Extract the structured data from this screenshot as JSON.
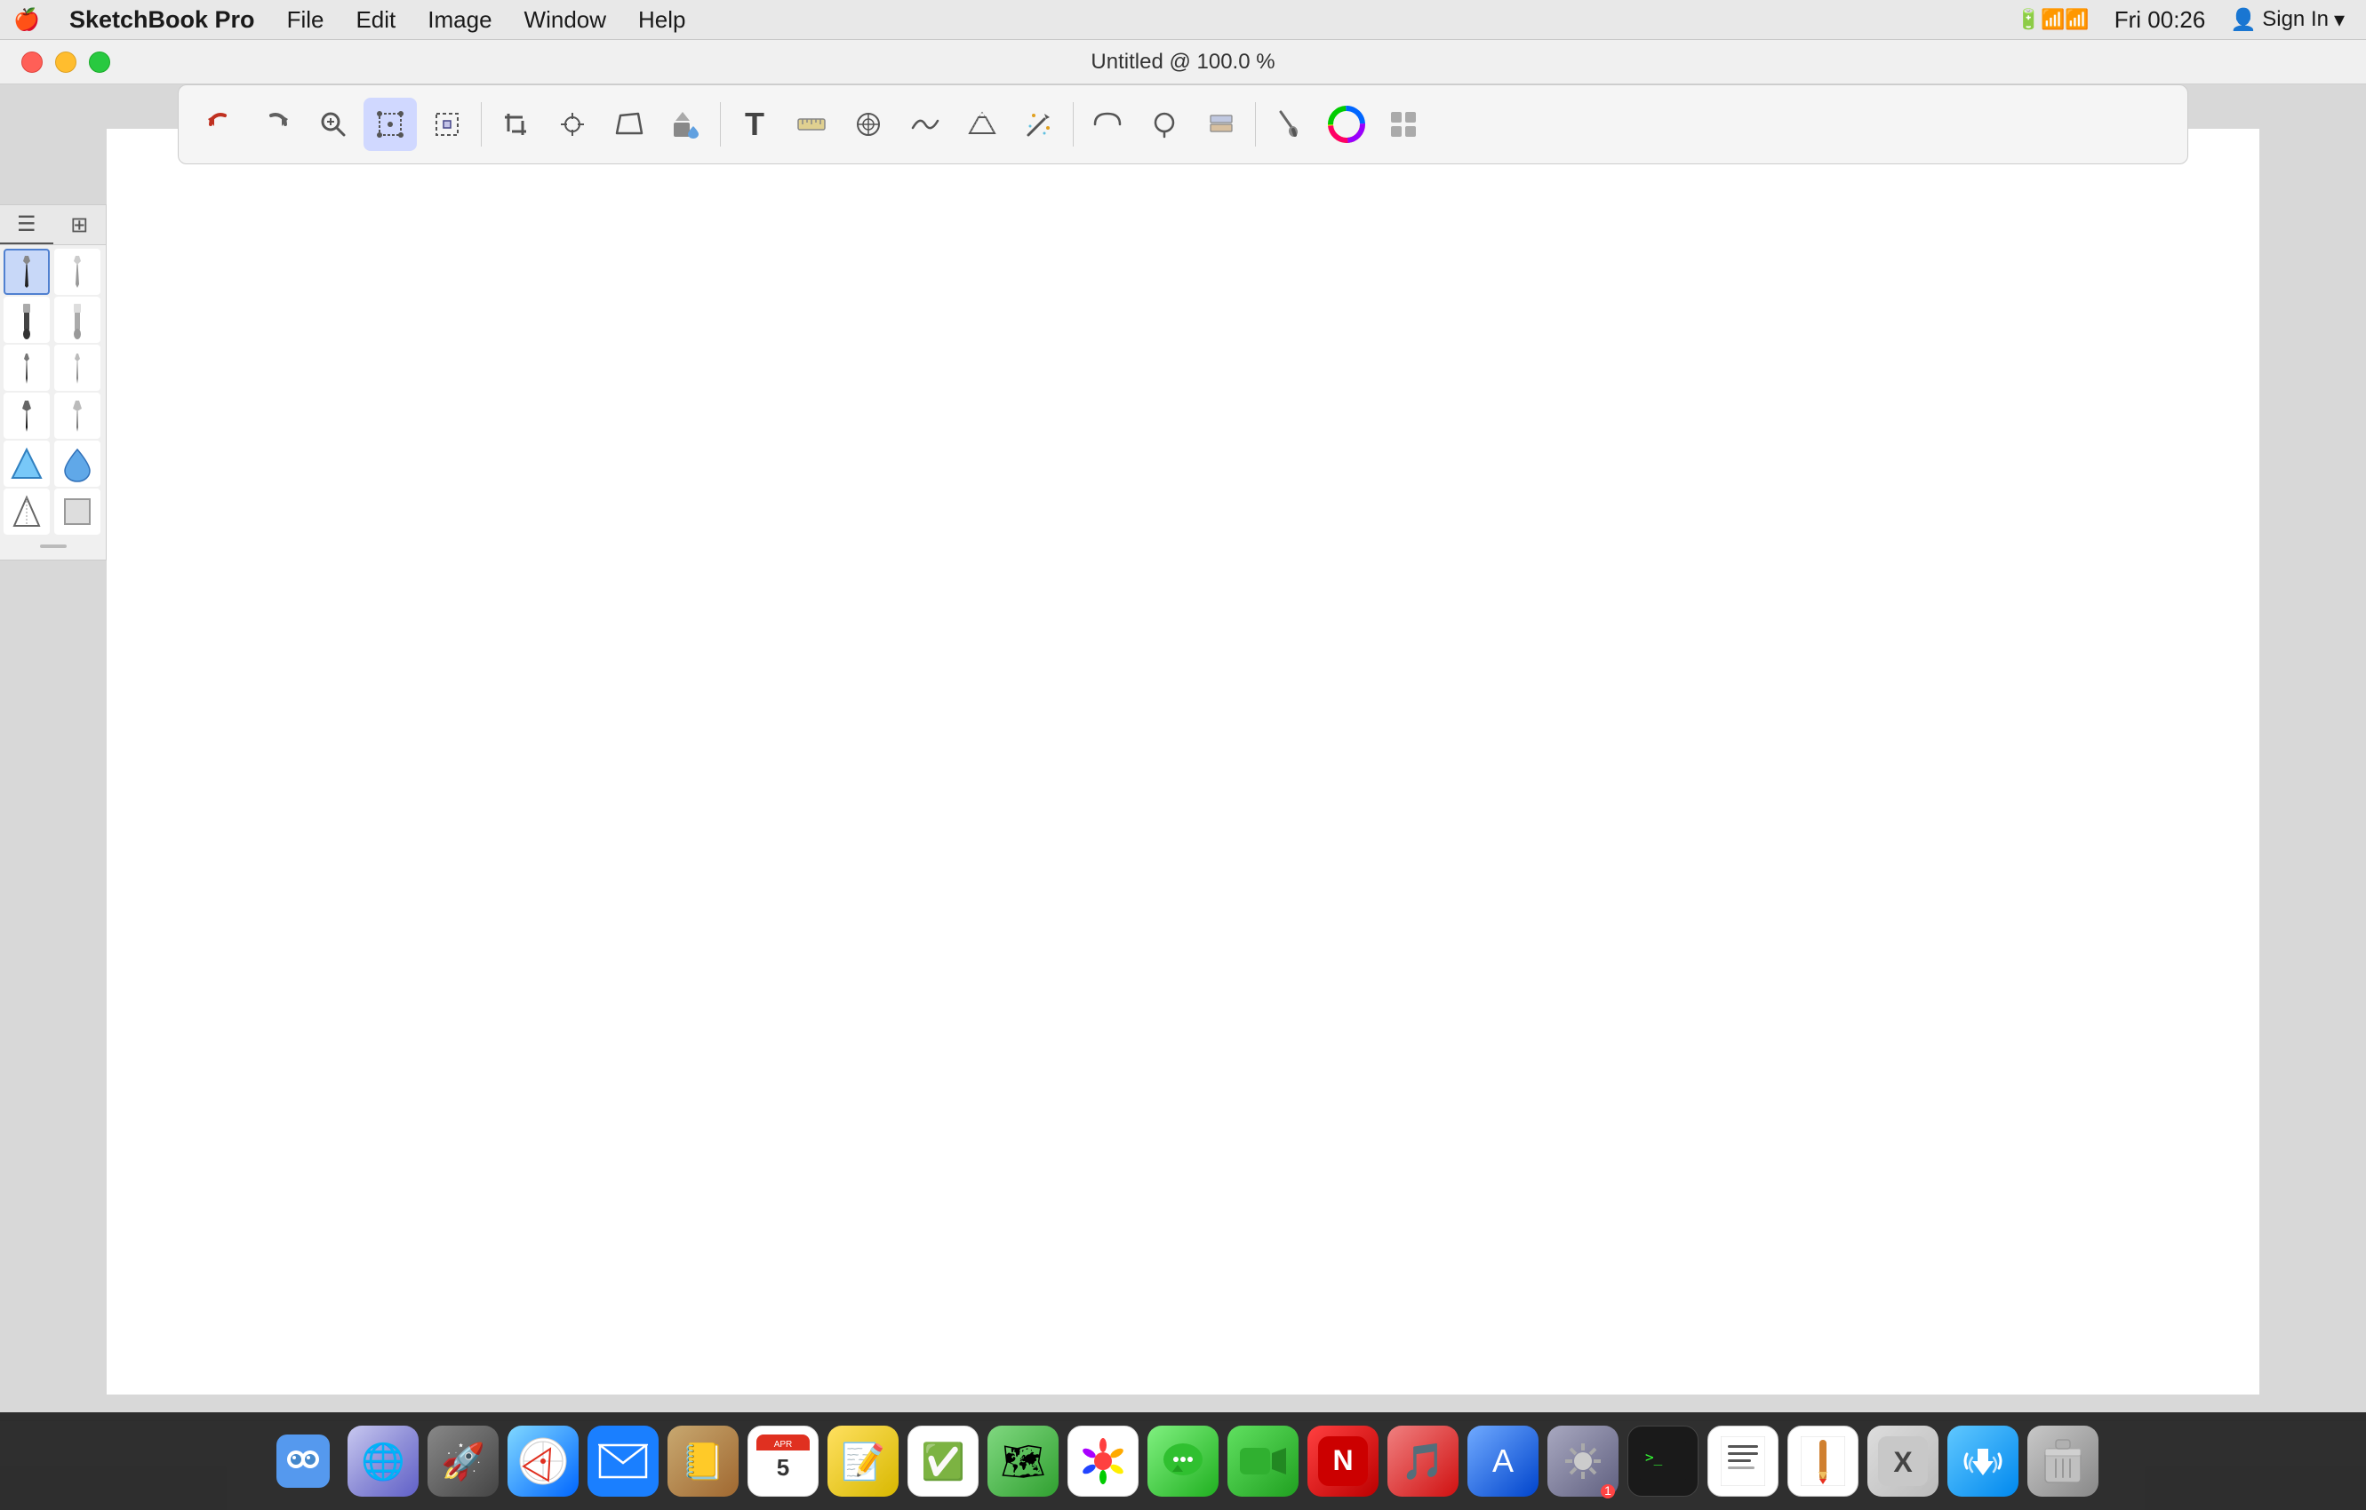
{
  "menubar": {
    "apple": "🍎",
    "app_name": "SketchBook Pro",
    "menus": [
      "File",
      "Edit",
      "Image",
      "Window",
      "Help"
    ],
    "time": "Fri 00:26",
    "sign_in": "Sign In"
  },
  "titlebar": {
    "title": "Untitled @ 100.0 %"
  },
  "toolbar": {
    "tools": [
      {
        "name": "undo",
        "label": "↩",
        "icon": "undo-icon"
      },
      {
        "name": "redo",
        "label": "↪",
        "icon": "redo-icon"
      },
      {
        "name": "zoom",
        "label": "🔍",
        "icon": "zoom-icon"
      },
      {
        "name": "select-move",
        "label": "⊹",
        "icon": "select-move-icon"
      },
      {
        "name": "select-box",
        "label": "⬚",
        "icon": "select-box-icon"
      },
      {
        "name": "crop",
        "label": "⧉",
        "icon": "crop-icon"
      },
      {
        "name": "transform",
        "label": "⊕",
        "icon": "transform-icon"
      },
      {
        "name": "distort",
        "label": "▱",
        "icon": "distort-icon"
      },
      {
        "name": "fill",
        "label": "🪣",
        "icon": "fill-icon"
      },
      {
        "name": "text",
        "label": "T",
        "icon": "text-icon"
      },
      {
        "name": "ruler",
        "label": "📐",
        "icon": "ruler-icon"
      },
      {
        "name": "symmetry",
        "label": "⊗",
        "icon": "symmetry-icon"
      },
      {
        "name": "stabilizer",
        "label": "∿",
        "icon": "stabilizer-icon"
      },
      {
        "name": "perspective",
        "label": "⬡",
        "icon": "perspective-icon"
      },
      {
        "name": "magic-wand",
        "label": "✦",
        "icon": "magic-wand-icon"
      },
      {
        "name": "ellipse",
        "label": "⌒",
        "icon": "ellipse-icon"
      },
      {
        "name": "lasso",
        "label": "⊙",
        "icon": "lasso-icon"
      },
      {
        "name": "layers",
        "label": "⧉",
        "icon": "layers-icon"
      },
      {
        "name": "brushes",
        "label": "✏",
        "icon": "brushes-icon"
      },
      {
        "name": "color-wheel",
        "label": "◑",
        "icon": "color-wheel-icon"
      },
      {
        "name": "layout",
        "label": "⊞",
        "icon": "layout-icon"
      }
    ]
  },
  "brush_panel": {
    "tabs": [
      {
        "name": "list-view",
        "label": "☰"
      },
      {
        "name": "grid-view",
        "label": "⊞"
      }
    ],
    "brushes": [
      {
        "id": 1,
        "selected": true,
        "type": "pencil-dark"
      },
      {
        "id": 2,
        "selected": false,
        "type": "pencil-light"
      },
      {
        "id": 3,
        "selected": false,
        "type": "marker-dark"
      },
      {
        "id": 4,
        "selected": false,
        "type": "marker-light"
      },
      {
        "id": 5,
        "selected": false,
        "type": "pen-fine"
      },
      {
        "id": 6,
        "selected": false,
        "type": "pen-medium"
      },
      {
        "id": 7,
        "selected": false,
        "type": "brush-fine"
      },
      {
        "id": 8,
        "selected": false,
        "type": "brush-medium"
      },
      {
        "id": 9,
        "selected": false,
        "type": "eraser-triangle"
      },
      {
        "id": 10,
        "selected": false,
        "type": "eraser-round"
      },
      {
        "id": 11,
        "selected": false,
        "type": "smudge"
      },
      {
        "id": 12,
        "selected": false,
        "type": "fill-rect"
      }
    ]
  },
  "dock": {
    "items": [
      {
        "name": "finder",
        "label": "Finder",
        "class": "finder",
        "icon": "🔵"
      },
      {
        "name": "siri",
        "label": "Siri",
        "class": "siri",
        "icon": "🌐"
      },
      {
        "name": "launchpad",
        "label": "Launchpad",
        "class": "launchpad",
        "icon": "🚀"
      },
      {
        "name": "safari",
        "label": "Safari",
        "class": "safari",
        "icon": "🧭"
      },
      {
        "name": "mail",
        "label": "Mail",
        "class": "mail",
        "icon": "✉"
      },
      {
        "name": "contacts",
        "label": "Contacts",
        "class": "contacts",
        "icon": "📒"
      },
      {
        "name": "calendar",
        "label": "Calendar",
        "class": "calendar",
        "icon": "5"
      },
      {
        "name": "notes",
        "label": "Notes",
        "class": "notes",
        "icon": "📝"
      },
      {
        "name": "reminders",
        "label": "Reminders",
        "class": "reminders",
        "icon": "📋"
      },
      {
        "name": "maps",
        "label": "Maps",
        "class": "maps",
        "icon": "🗺"
      },
      {
        "name": "photos",
        "label": "Photos",
        "class": "photos",
        "icon": "🌸"
      },
      {
        "name": "messages",
        "label": "Messages",
        "class": "messages",
        "icon": "💬"
      },
      {
        "name": "facetime",
        "label": "FaceTime",
        "class": "facetime",
        "icon": "📹"
      },
      {
        "name": "news",
        "label": "News",
        "class": "news",
        "icon": "📰"
      },
      {
        "name": "music",
        "label": "Music",
        "class": "music",
        "icon": "🎵"
      },
      {
        "name": "appstore",
        "label": "App Store",
        "class": "appstore",
        "icon": "A"
      },
      {
        "name": "sysprefs",
        "label": "System Preferences",
        "class": "sysprefs",
        "icon": "⚙"
      },
      {
        "name": "terminal",
        "label": "Terminal",
        "class": "terminal",
        "icon": ">_"
      },
      {
        "name": "textedit",
        "label": "TextEdit",
        "class": "textedit",
        "icon": "📄"
      },
      {
        "name": "pencil",
        "label": "Pencil",
        "class": "pencil",
        "icon": "✏"
      },
      {
        "name": "sketch-x",
        "label": "Sketch X",
        "class": "sketch-x",
        "icon": "X"
      },
      {
        "name": "airdrop",
        "label": "AirDrop",
        "class": "airdrop",
        "icon": "📡"
      },
      {
        "name": "trash",
        "label": "Trash",
        "class": "trash",
        "icon": "🗑"
      }
    ]
  }
}
